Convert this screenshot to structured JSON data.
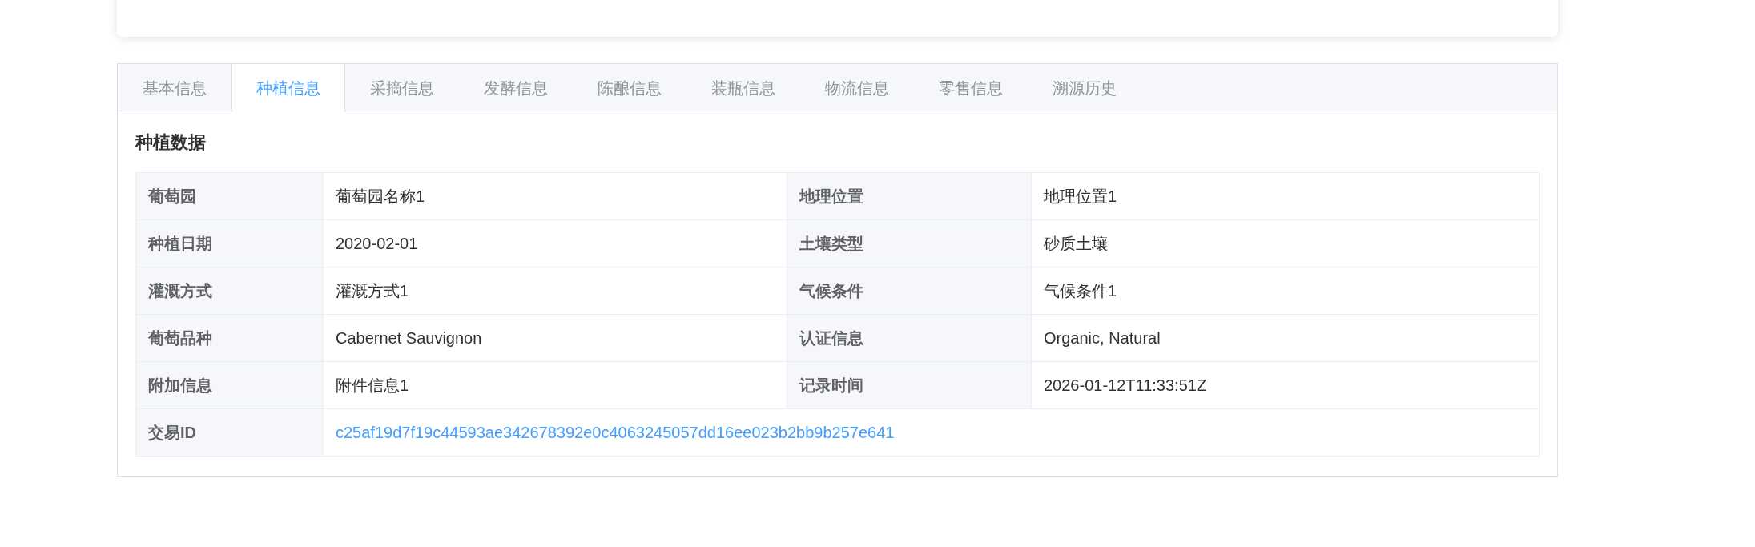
{
  "tabs": [
    {
      "label": "基本信息",
      "selected": false
    },
    {
      "label": "种植信息",
      "selected": true
    },
    {
      "label": "采摘信息",
      "selected": false
    },
    {
      "label": "发酵信息",
      "selected": false
    },
    {
      "label": "陈酿信息",
      "selected": false
    },
    {
      "label": "装瓶信息",
      "selected": false
    },
    {
      "label": "物流信息",
      "selected": false
    },
    {
      "label": "零售信息",
      "selected": false
    },
    {
      "label": "溯源历史",
      "selected": false
    }
  ],
  "section_title": "种植数据",
  "rows": [
    [
      {
        "label": "葡萄园",
        "value": "葡萄园名称1",
        "kind": "text"
      },
      {
        "label": "地理位置",
        "value": "地理位置1",
        "kind": "text"
      }
    ],
    [
      {
        "label": "种植日期",
        "value": "2020-02-01",
        "kind": "text"
      },
      {
        "label": "土壤类型",
        "value": "砂质土壤",
        "kind": "text"
      }
    ],
    [
      {
        "label": "灌溉方式",
        "value": "灌溉方式1",
        "kind": "text"
      },
      {
        "label": "气候条件",
        "value": "气候条件1",
        "kind": "text"
      }
    ],
    [
      {
        "label": "葡萄品种",
        "value": "Cabernet Sauvignon",
        "kind": "text"
      },
      {
        "label": "认证信息",
        "value": "Organic, Natural",
        "kind": "text"
      }
    ],
    [
      {
        "label": "附加信息",
        "value": "附件信息1",
        "kind": "text"
      },
      {
        "label": "记录时间",
        "value": "2026-01-12T11:33:51Z",
        "kind": "text"
      }
    ],
    [
      {
        "label": "交易ID",
        "value": "c25af19d7f19c44593ae342678392e0c4063245057dd16ee023b2bb9b257e641",
        "kind": "link"
      }
    ]
  ]
}
